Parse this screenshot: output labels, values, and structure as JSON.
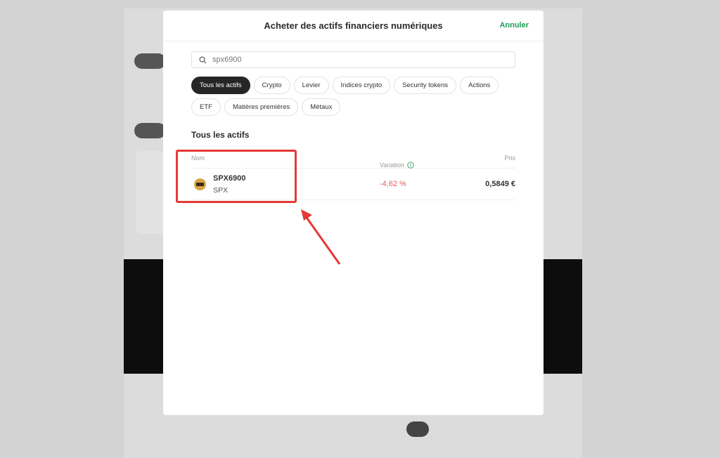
{
  "modal": {
    "title": "Acheter des actifs financiers numériques",
    "cancel": "Annuler",
    "search": {
      "value": "spx6900",
      "icon": "search-icon"
    },
    "filters": [
      "Tous les actifs",
      "Crypto",
      "Levier",
      "Indices crypto",
      "Security tokens",
      "Actions",
      "ETF",
      "Matières premières",
      "Métaux"
    ],
    "active_filter": "Tous les actifs",
    "section_title": "Tous les actifs",
    "table": {
      "columns": {
        "name": "Nom",
        "change": "Variation",
        "price": "Prix"
      },
      "rows": [
        {
          "name": "SPX6900",
          "symbol": "SPX",
          "change": "-4,62 %",
          "price": "0,5849 €"
        }
      ]
    }
  },
  "colors": {
    "accent": "#1f9a5a",
    "negative": "#e0605a",
    "annotation": "#e53935"
  }
}
